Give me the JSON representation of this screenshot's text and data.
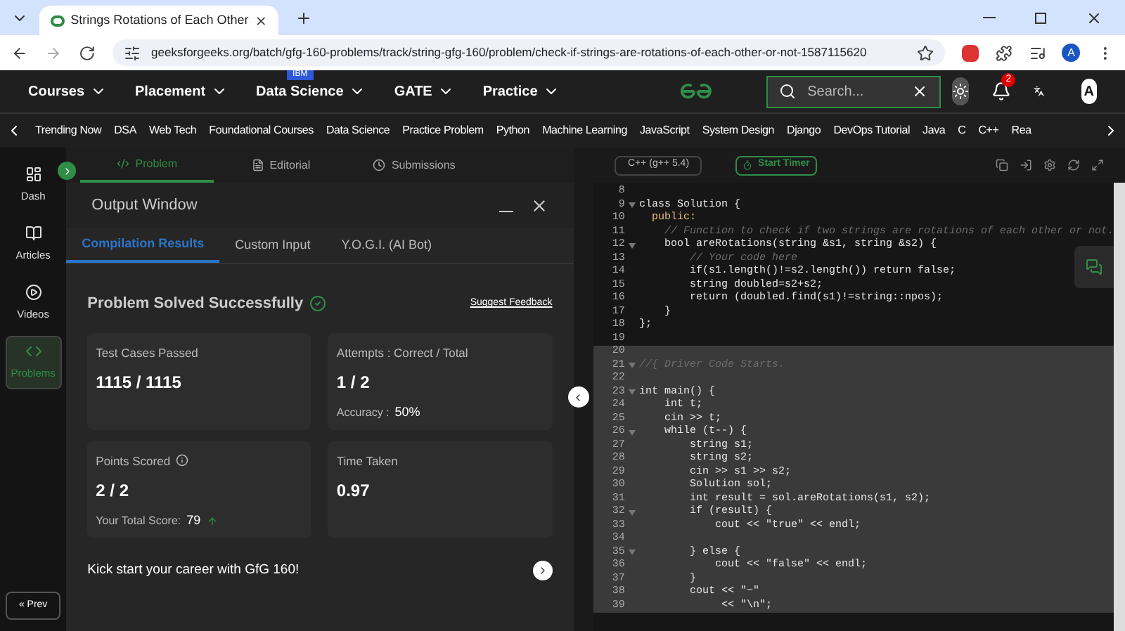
{
  "browser": {
    "tab_title": "Strings Rotations of Each Other",
    "url": "geeksforgeeks.org/batch/gfg-160-problems/track/string-gfg-160/problem/check-if-strings-are-rotations-of-each-other-or-not-1587115620",
    "profile_initial": "A"
  },
  "site_nav": {
    "menus": [
      {
        "label": "Courses"
      },
      {
        "label": "Placement"
      },
      {
        "label": "Data Science",
        "badge": "IBM"
      },
      {
        "label": "GATE"
      },
      {
        "label": "Practice"
      }
    ],
    "search": {
      "placeholder": "Search..."
    },
    "notification_count": "2",
    "avatar_initial": "A"
  },
  "topics": [
    "Trending Now",
    "DSA",
    "Web Tech",
    "Foundational Courses",
    "Data Science",
    "Practice Problem",
    "Python",
    "Machine Learning",
    "JavaScript",
    "System Design",
    "Django",
    "DevOps Tutorial",
    "Java",
    "C",
    "C++",
    "Rea"
  ],
  "sidebar": {
    "items": [
      {
        "label": "Dash",
        "kind": "dash",
        "selected": false
      },
      {
        "label": "Articles",
        "kind": "articles",
        "selected": false
      },
      {
        "label": "Videos",
        "kind": "videos",
        "selected": false
      },
      {
        "label": "Problems",
        "kind": "problems",
        "selected": true
      }
    ],
    "prev_button": "« Prev"
  },
  "problem_tabs": [
    {
      "label": "Problem",
      "kind": "problem",
      "selected": true
    },
    {
      "label": "Editorial",
      "kind": "editorial",
      "selected": false
    },
    {
      "label": "Submissions",
      "kind": "submissions",
      "selected": false
    }
  ],
  "output_window": {
    "title": "Output Window",
    "tabs": [
      {
        "label": "Compilation Results",
        "selected": true
      },
      {
        "label": "Custom Input",
        "selected": false
      },
      {
        "label": "Y.O.G.I. (AI Bot)",
        "selected": false
      }
    ],
    "status": "Problem Solved Successfully",
    "feedback_link": "Suggest Feedback",
    "cards": [
      {
        "label": "Test Cases Passed",
        "value": "1115 / 1115"
      },
      {
        "label": "Attempts : Correct / Total",
        "value": "1 / 2",
        "note_label": "Accuracy :",
        "note_value": "50%"
      },
      {
        "label": "Points Scored",
        "value": "2 / 2",
        "note_label": "Your Total Score:",
        "note_value": "79",
        "info": true,
        "trend_up": true
      },
      {
        "label": "Time Taken",
        "value": "0.97"
      }
    ],
    "promo": "Kick start your career with GfG 160!"
  },
  "editor": {
    "language": "C++ (g++ 5.4)",
    "timer_button": "Start Timer",
    "solution_lines": [
      {
        "number": "8"
      },
      {
        "number": "9",
        "text": "class Solution {",
        "kind": "code",
        "foldable": true
      },
      {
        "number": "10",
        "text": "  public:",
        "kind": "keyword"
      },
      {
        "number": "11",
        "text": "    // Function to check if two strings are rotations of each other or not.",
        "kind": "comment"
      },
      {
        "number": "12",
        "text": "    bool areRotations(string &s1, string &s2) {",
        "kind": "code",
        "foldable": true
      },
      {
        "number": "13",
        "text": "        // Your code here",
        "kind": "comment"
      },
      {
        "number": "14",
        "text": "        if(s1.length()!=s2.length()) return false;",
        "kind": "code"
      },
      {
        "number": "15",
        "text": "        string doubled=s2+s2;",
        "kind": "code"
      },
      {
        "number": "16",
        "text": "        return (doubled.find(s1)!=string::npos);",
        "kind": "code"
      },
      {
        "number": "17",
        "text": "    }",
        "kind": "code"
      },
      {
        "number": "18",
        "text": "};",
        "kind": "code"
      },
      {
        "number": "19"
      }
    ],
    "driver_lines": [
      {
        "number": "20"
      },
      {
        "number": "21",
        "text": "//{ Driver Code Starts.",
        "kind": "comment",
        "foldable": true
      },
      {
        "number": "22"
      },
      {
        "number": "23",
        "text": "int main() {",
        "kind": "code",
        "foldable": true
      },
      {
        "number": "24",
        "text": "    int t;",
        "kind": "code"
      },
      {
        "number": "25",
        "text": "    cin >> t;",
        "kind": "code"
      },
      {
        "number": "26",
        "text": "    while (t--) {",
        "kind": "code",
        "foldable": true
      },
      {
        "number": "27",
        "text": "        string s1;",
        "kind": "code"
      },
      {
        "number": "28",
        "text": "        string s2;",
        "kind": "code"
      },
      {
        "number": "29",
        "text": "        cin >> s1 >> s2;",
        "kind": "code"
      },
      {
        "number": "30",
        "text": "        Solution sol;",
        "kind": "code"
      },
      {
        "number": "31",
        "text": "        int result = sol.areRotations(s1, s2);",
        "kind": "code"
      },
      {
        "number": "32",
        "text": "        if (result) {",
        "kind": "code",
        "foldable": true
      },
      {
        "number": "33",
        "text": "            cout << \"true\" << endl;",
        "kind": "code"
      },
      {
        "number": "34"
      },
      {
        "number": "35",
        "text": "        } else {",
        "kind": "code",
        "foldable": true
      },
      {
        "number": "36",
        "text": "            cout << \"false\" << endl;",
        "kind": "code"
      },
      {
        "number": "37",
        "text": "        }",
        "kind": "code"
      },
      {
        "number": "38",
        "text": "        cout << \"~\"",
        "kind": "code"
      },
      {
        "number": "39",
        "text": "             << \"\\n\";",
        "kind": "code"
      }
    ]
  }
}
